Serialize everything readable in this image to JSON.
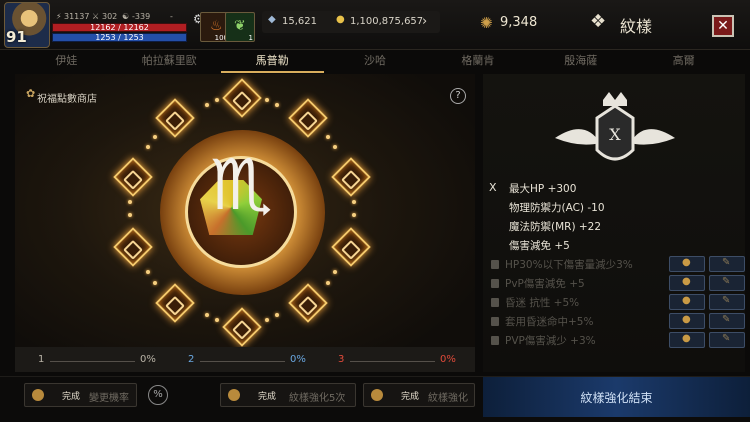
{
  "player": {
    "level": "91",
    "power": "31137",
    "stat_a": "302",
    "stat_b": "-339",
    "stat_c": "-",
    "hp": "12162 / 12162",
    "mp": "1253 / 1253"
  },
  "slots": [
    {
      "icon": "potion-icon",
      "count": "100"
    },
    {
      "icon": "leaf-icon",
      "count": "1"
    }
  ],
  "currency": {
    "diamonds": "15,621",
    "gold": "1,100,875,657",
    "blessing_coins": "9,348"
  },
  "header": {
    "title": "紋樣",
    "close_label": "✕"
  },
  "tabs": [
    {
      "label": "伊娃",
      "active": false
    },
    {
      "label": "帕拉蘇里歐",
      "active": false
    },
    {
      "label": "馬普勒",
      "active": true
    },
    {
      "label": "沙哈",
      "active": false
    },
    {
      "label": "格蘭肯",
      "active": false
    },
    {
      "label": "殷海薩",
      "active": false
    },
    {
      "label": "高爾",
      "active": false
    }
  ],
  "shop": {
    "label": "祝福點數商店",
    "help": "?"
  },
  "progress": [
    {
      "index": "1",
      "percent": "0%",
      "color": "#b9b3a6"
    },
    {
      "index": "2",
      "percent": "0%",
      "color": "#6aa7e0"
    },
    {
      "index": "3",
      "percent": "0%",
      "color": "#e04a3a"
    }
  ],
  "emblem": {
    "roman": "X"
  },
  "stats": {
    "marker": "X",
    "active": [
      "最大HP +300",
      "物理防禦力(AC) -10",
      "魔法防禦(MR) +22",
      "傷害減免 +5"
    ],
    "locked": [
      "HP30%以下傷害量減少3%",
      "PvP傷害減免 +5",
      "昏迷 抗性 +5%",
      "套用昏迷命中+5%",
      "PVP傷害減少 +3%"
    ]
  },
  "bottom": {
    "btn1": {
      "done": "完成",
      "label": "變更機率"
    },
    "percent_icon": "%",
    "btn2": {
      "done": "完成",
      "label": "紋樣強化5次"
    },
    "btn3": {
      "done": "完成",
      "label": "紋樣強化"
    },
    "finish": "紋樣強化結束"
  }
}
